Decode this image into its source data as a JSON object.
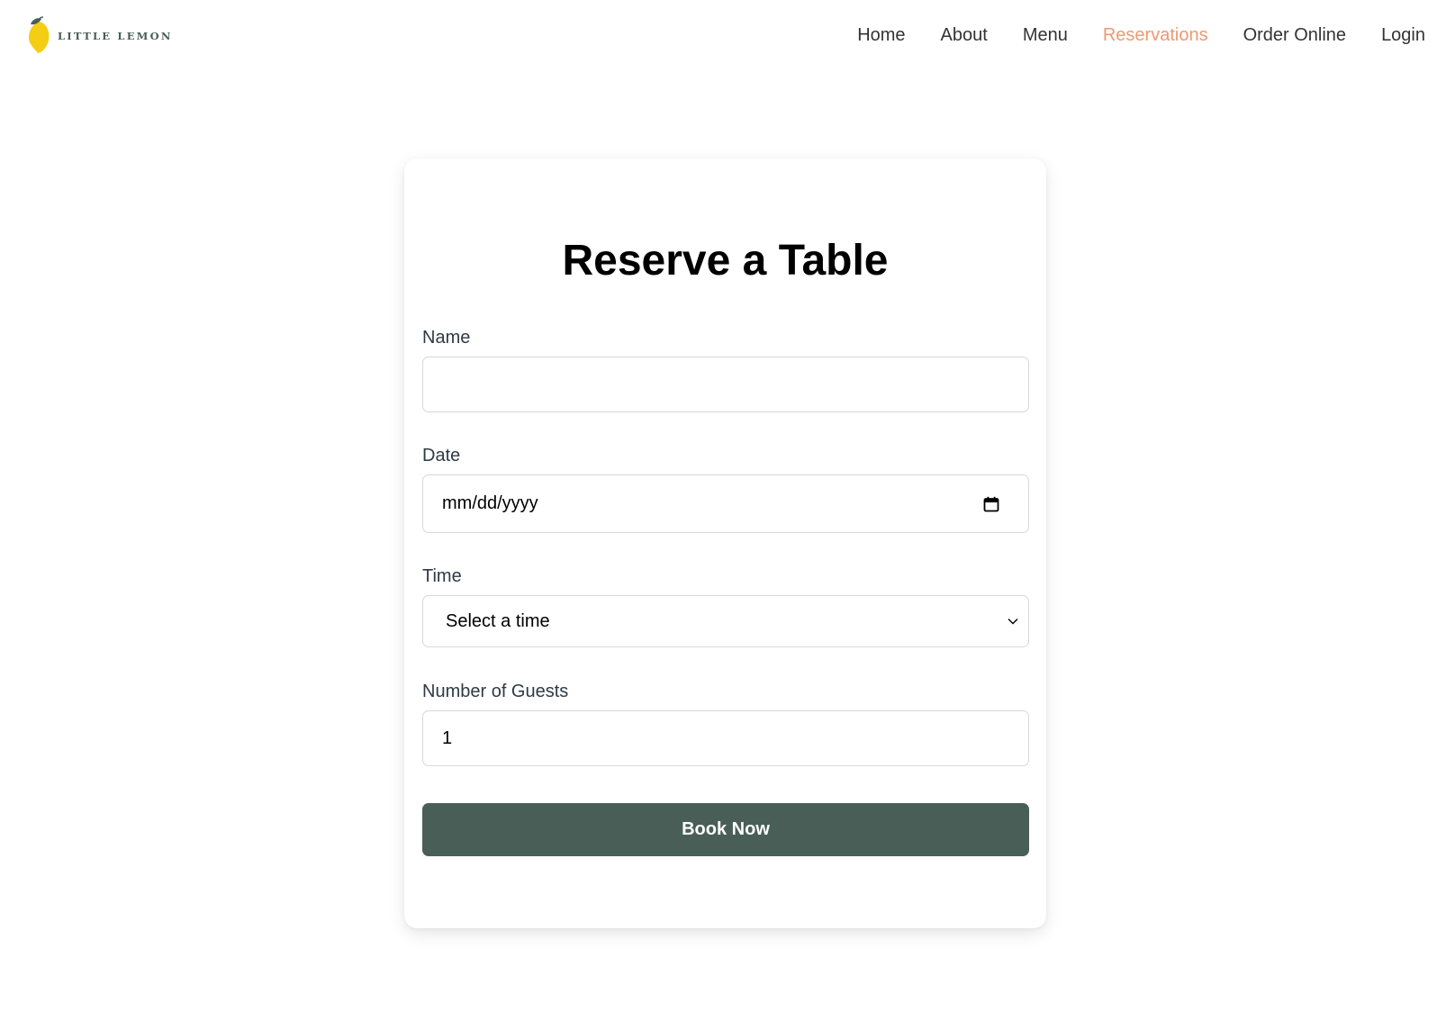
{
  "header": {
    "logo_text": "LITTLE LEMON",
    "nav": [
      {
        "label": "Home",
        "active": false
      },
      {
        "label": "About",
        "active": false
      },
      {
        "label": "Menu",
        "active": false
      },
      {
        "label": "Reservations",
        "active": true
      },
      {
        "label": "Order Online",
        "active": false
      },
      {
        "label": "Login",
        "active": false
      }
    ]
  },
  "form": {
    "title": "Reserve a Table",
    "name": {
      "label": "Name",
      "value": ""
    },
    "date": {
      "label": "Date",
      "placeholder": "mm/dd/yyyy",
      "icon": "calendar-icon"
    },
    "time": {
      "label": "Time",
      "selected": "Select a time",
      "icon": "chevron-down-icon"
    },
    "guests": {
      "label": "Number of Guests",
      "value": "1"
    },
    "submit_label": "Book Now"
  },
  "colors": {
    "brand_green": "#495e57",
    "accent_salmon": "#ee9972",
    "lemon_yellow": "#f4ce14"
  }
}
